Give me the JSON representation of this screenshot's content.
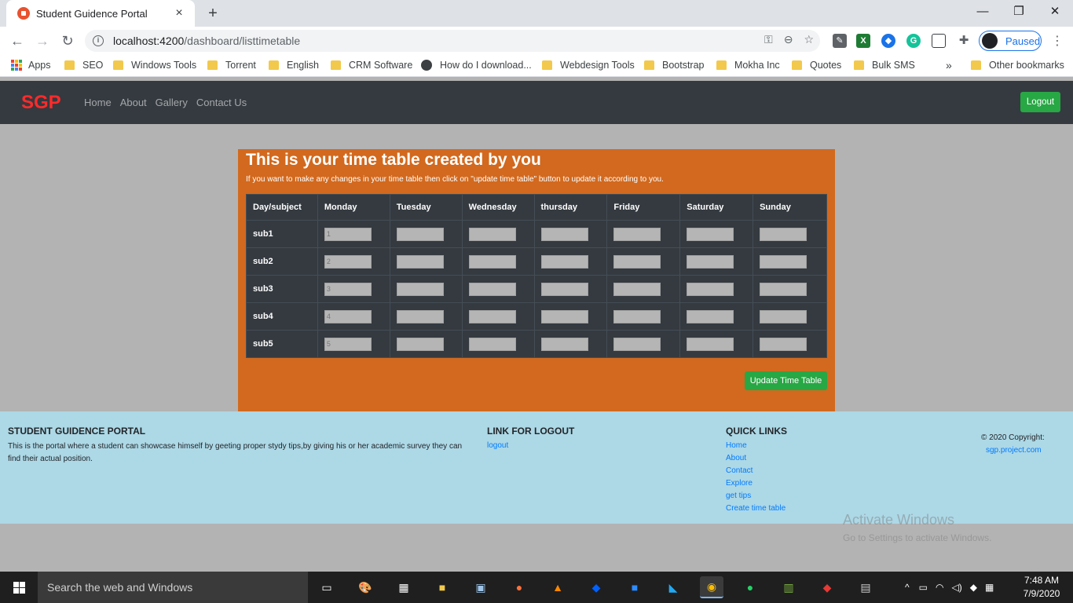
{
  "browser": {
    "tab_title": "Student Guidence Portal",
    "tab_close": "×",
    "new_tab": "+",
    "url_host": "localhost:4200",
    "url_path": "/dashboard/listtimetable",
    "profile_status": "Paused",
    "minimize": "—",
    "restore": "❐",
    "close": "✕"
  },
  "bookmarks": {
    "apps": "Apps",
    "items": [
      "SEO",
      "Windows Tools",
      "Torrent",
      "English",
      "CRM Software",
      "How do I download...",
      "Webdesign Tools",
      "Bootstrap",
      "Mokha Inc",
      "Quotes",
      "Bulk SMS"
    ],
    "more": "»",
    "other": "Other bookmarks"
  },
  "navbar": {
    "brand": "SGP",
    "links": [
      "Home",
      "About",
      "Gallery",
      "Contact Us"
    ],
    "logout": "Logout"
  },
  "timetable": {
    "title": "This is your time table created by you",
    "subtitle": "If you want to make any changes in your time table then click on \"update time table\" button to update it according to you.",
    "headers": [
      "Day/subject",
      "Monday",
      "Tuesday",
      "Wednesday",
      "thursday",
      "Friday",
      "Saturday",
      "Sunday"
    ],
    "rows": [
      {
        "subject": "sub1",
        "values": [
          "1",
          "",
          "",
          "",
          "",
          "",
          ""
        ]
      },
      {
        "subject": "sub2",
        "values": [
          "2",
          "",
          "",
          "",
          "",
          "",
          ""
        ]
      },
      {
        "subject": "sub3",
        "values": [
          "3",
          "",
          "",
          "",
          "",
          "",
          ""
        ]
      },
      {
        "subject": "sub4",
        "values": [
          "4",
          "",
          "",
          "",
          "",
          "",
          ""
        ]
      },
      {
        "subject": "sub5",
        "values": [
          "5",
          "",
          "",
          "",
          "",
          "",
          ""
        ]
      }
    ],
    "update_button": "Update Time Table"
  },
  "footer": {
    "portal_heading": "STUDENT GUIDENCE PORTAL",
    "portal_text": "This is the portal where a student can showcase himself by geeting proper stydy tips,by giving his or her academic survey they can find their actual position.",
    "logout_heading": "LINK FOR LOGOUT",
    "logout_link": "logout",
    "quick_heading": "QUICK LINKS",
    "quick_links": [
      "Home",
      "About",
      "Contact",
      "Explore",
      "get tips",
      "Create time table"
    ],
    "copyright": "© 2020 Copyright:",
    "site": "sgp.project.com"
  },
  "watermark": {
    "line1": "Activate Windows",
    "line2": "Go to Settings to activate Windows."
  },
  "taskbar": {
    "search_placeholder": "Search the web and Windows",
    "time": "7:48 AM",
    "date": "7/9/2020"
  }
}
